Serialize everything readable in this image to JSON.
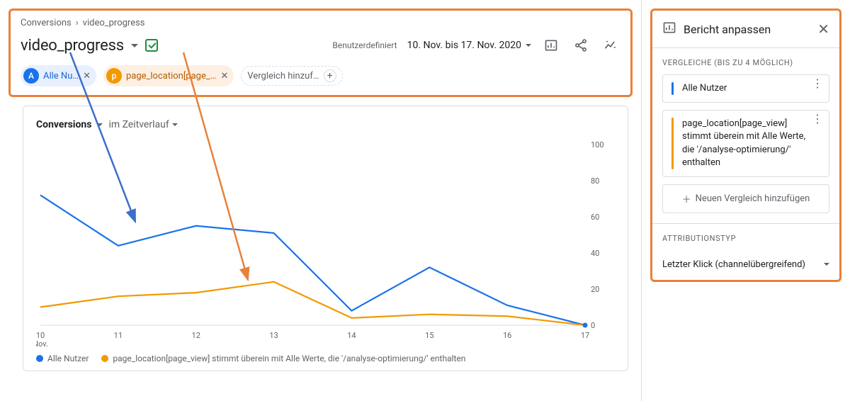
{
  "breadcrumb": {
    "root": "Conversions",
    "current": "video_progress"
  },
  "title": "video_progress",
  "date": {
    "label": "Benutzerdefiniert",
    "value": "10. Nov. bis 17. Nov. 2020"
  },
  "chips": {
    "a_label": "Alle Nu…",
    "b_label": "page_location[page_…",
    "add_label": "Vergleich hinzuf…"
  },
  "chart": {
    "metric": "Conversions",
    "timeframe": "im Zeitverlauf",
    "legend_a": "Alle Nutzer",
    "legend_b": "page_location[page_view] stimmt überein mit Alle Werte, die '/analyse-optimierung/' enthalten",
    "x_month": "Nov."
  },
  "chart_data": {
    "type": "line",
    "categories": [
      "10",
      "11",
      "12",
      "13",
      "14",
      "15",
      "16",
      "17"
    ],
    "series": [
      {
        "name": "Alle Nutzer",
        "color": "#1a73e8",
        "values": [
          72,
          44,
          55,
          51,
          8,
          32,
          11,
          0
        ]
      },
      {
        "name": "page_location[page_view]",
        "color": "#f29900",
        "values": [
          10,
          16,
          18,
          24,
          4,
          6,
          5,
          0
        ]
      }
    ],
    "ylabel": "",
    "xlabel": "",
    "ylim": [
      0,
      100
    ],
    "yticks": [
      0,
      20,
      40,
      60,
      80,
      100
    ]
  },
  "right": {
    "title": "Bericht anpassen",
    "compare_label": "VERGLEICHE (BIS ZU 4 MÖGLICH)",
    "compare_a": "Alle Nutzer",
    "compare_b": "page_location[page_view] stimmt überein mit Alle Werte, die '/analyse-optimierung/' enthalten",
    "add_compare": "Neuen Vergleich hinzufügen",
    "attribution_label": "ATTRIBUTIONSTYP",
    "attribution_value": "Letzter Klick (channelübergreifend)"
  }
}
